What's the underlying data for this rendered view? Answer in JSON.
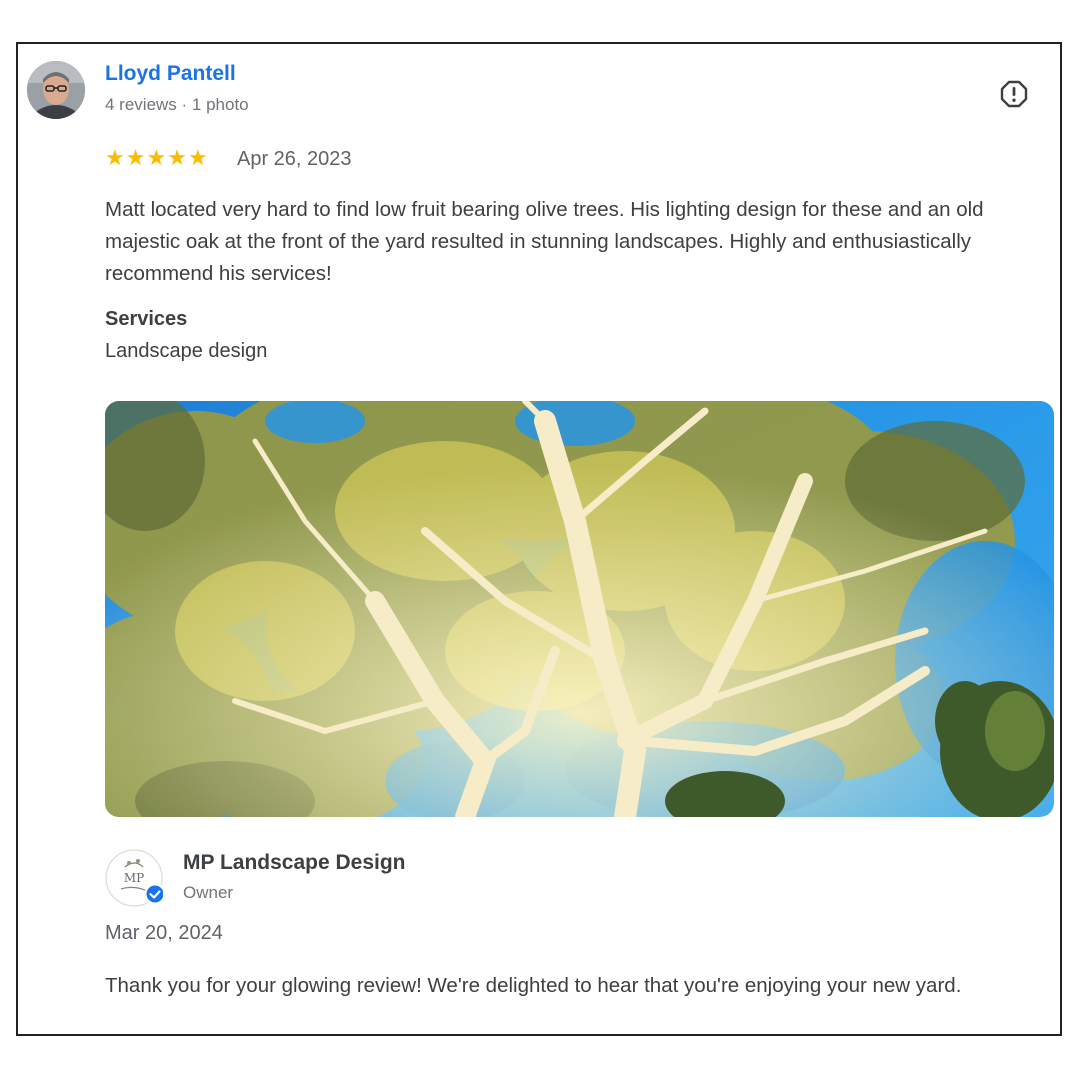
{
  "review": {
    "reviewer_name": "Lloyd Pantell",
    "reviewer_meta": "4 reviews · 1 photo",
    "rating": 5,
    "stars": [
      "★",
      "★",
      "★",
      "★",
      "★"
    ],
    "date": "Apr 26, 2023",
    "text": "Matt located very hard to find low fruit bearing olive trees. His lighting design for these and an old majestic oak at the front of the yard resulted in stunning landscapes. Highly and enthusiastically recommend his services!",
    "services_heading": "Services",
    "services_value": "Landscape design",
    "report_icon": "report-flag-icon",
    "star_color": "#fbbc04",
    "name_color": "#1a73e8"
  },
  "owner_reply": {
    "owner_name": "MP Landscape Design",
    "owner_role": "Owner",
    "logo_monogram": "MP",
    "verified_icon": "verified-badge-icon",
    "date": "Mar 20, 2024",
    "text": "Thank you for your glowing review! We're delighted to hear that you're enjoying your new yard."
  }
}
